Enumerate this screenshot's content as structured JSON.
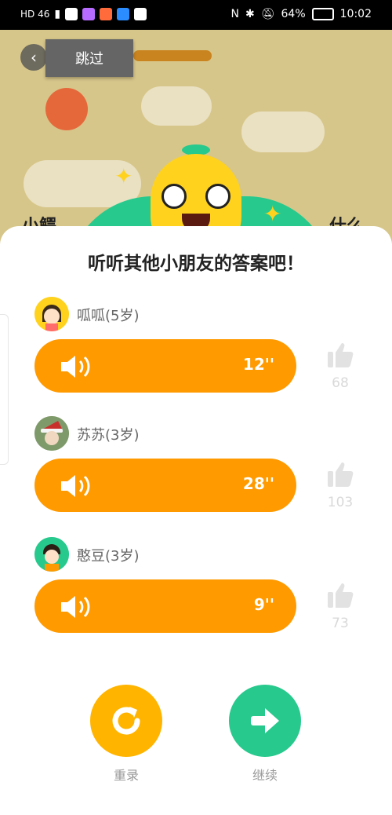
{
  "status_bar": {
    "network": "HD 46",
    "battery": "64%",
    "time": "10:02"
  },
  "top": {
    "back_icon": "chevron-left-icon",
    "skip_label": "跳过",
    "bg_text_left": "小鳄",
    "bg_text_right": "什么"
  },
  "sheet": {
    "title": "听听其他小朋友的答案吧！",
    "answers": [
      {
        "name": "呱呱(5岁)",
        "duration": "12''",
        "likes": "68"
      },
      {
        "name": "苏苏(3岁)",
        "duration": "28''",
        "likes": "103"
      },
      {
        "name": "憨豆(3岁)",
        "duration": "9''",
        "likes": "73"
      }
    ],
    "rerecord_label": "重录",
    "continue_label": "继续"
  },
  "colors": {
    "accent_orange": "#ff9a00",
    "rerecord_yellow": "#ffb400",
    "continue_green": "#27c98d"
  }
}
